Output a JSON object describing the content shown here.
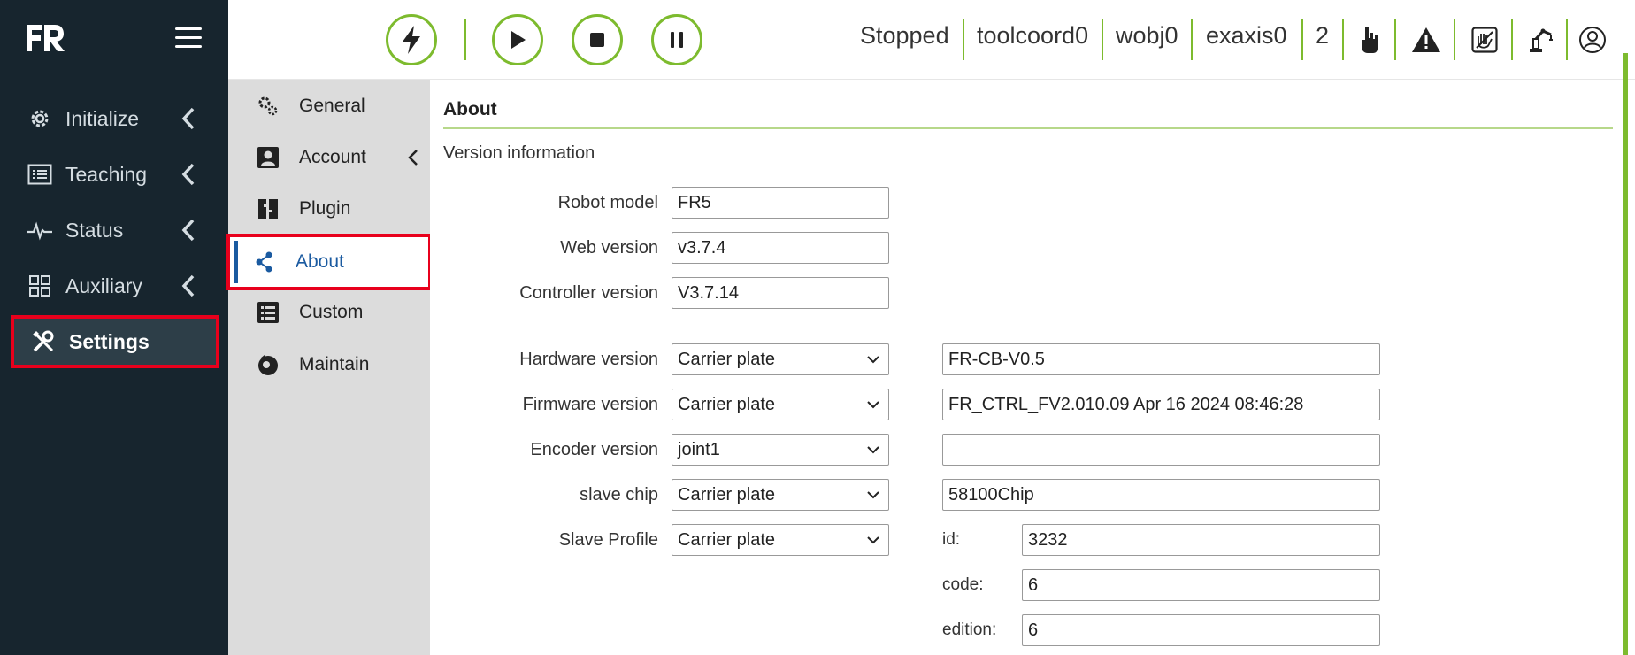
{
  "app": {
    "logo_text": "FR"
  },
  "sidebar": {
    "items": [
      {
        "label": "Initialize",
        "icon": "gear-icon"
      },
      {
        "label": "Teaching",
        "icon": "list-icon"
      },
      {
        "label": "Status",
        "icon": "pulse-icon"
      },
      {
        "label": "Auxiliary",
        "icon": "grid-icon"
      },
      {
        "label": "Settings",
        "icon": "tools-icon",
        "active": true
      }
    ]
  },
  "topbar": {
    "buttons": [
      "enable-icon",
      "play-icon",
      "stop-icon",
      "pause-icon"
    ],
    "status": "Stopped",
    "toolcoord": "toolcoord0",
    "wobj": "wobj0",
    "exaxis": "exaxis0",
    "mode_number": "2",
    "accent_color": "#7dbb2e"
  },
  "submenu": {
    "items": [
      {
        "label": "General",
        "icon": "gears-icon"
      },
      {
        "label": "Account",
        "icon": "account-icon"
      },
      {
        "label": "Plugin",
        "icon": "plugin-icon"
      },
      {
        "label": "About",
        "icon": "share-icon",
        "active": true
      },
      {
        "label": "Custom",
        "icon": "table-icon"
      },
      {
        "label": "Maintain",
        "icon": "maintain-icon"
      }
    ]
  },
  "main": {
    "title": "About",
    "subtitle": "Version information",
    "robot_model": {
      "label": "Robot model",
      "value": "FR5"
    },
    "web_version": {
      "label": "Web version",
      "value": "v3.7.4"
    },
    "controller_version": {
      "label": "Controller version",
      "value": "V3.7.14"
    },
    "hardware_version": {
      "label": "Hardware version",
      "select": "Carrier plate",
      "value": "FR-CB-V0.5"
    },
    "firmware_version": {
      "label": "Firmware version",
      "select": "Carrier plate",
      "value": "FR_CTRL_FV2.010.09 Apr 16 2024 08:46:28"
    },
    "encoder_version": {
      "label": "Encoder version",
      "select": "joint1",
      "value": ""
    },
    "slave_chip": {
      "label": "slave chip",
      "select": "Carrier plate",
      "value": "58100Chip"
    },
    "slave_profile": {
      "label": "Slave Profile",
      "select": "Carrier plate",
      "id_label": "id:",
      "id": "3232",
      "code_label": "code:",
      "code": "6",
      "edition_label": "edition:",
      "edition": "6"
    }
  }
}
